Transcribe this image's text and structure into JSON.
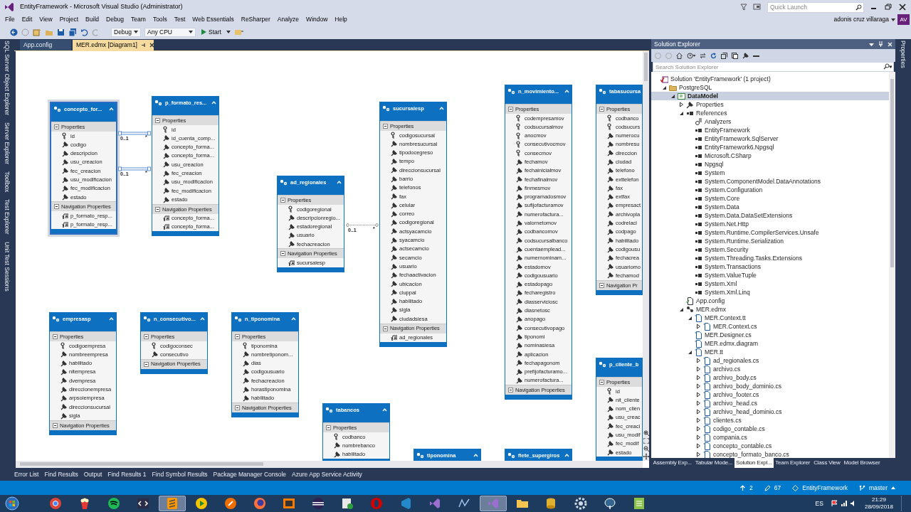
{
  "window": {
    "title": "EntityFramework - Microsoft Visual Studio (Administrator)"
  },
  "quick_launch": {
    "placeholder": "Quick Launch"
  },
  "user": {
    "name": "adonis cruz villaraga",
    "initials": "AV"
  },
  "menu": [
    "File",
    "Edit",
    "View",
    "Project",
    "Build",
    "Debug",
    "Team",
    "Tools",
    "Test",
    "Web Essentials",
    "ReSharper",
    "Analyze",
    "Window",
    "Help"
  ],
  "toolbar": {
    "configuration": "Debug",
    "platform": "Any CPU",
    "start": "Start"
  },
  "left_tool_strip": [
    "SQL Server Object Explorer",
    "Server Explorer",
    "Toolbox",
    "Test Explorer",
    "Unit Test Sessions"
  ],
  "right_tool_strip": [
    "Properties"
  ],
  "document_tabs": [
    {
      "label": "App.config",
      "selected": false
    },
    {
      "label": "MER.edmx [Diagram1]",
      "selected": true
    }
  ],
  "diagram": {
    "entities": [
      {
        "title": "concepto_for...",
        "selected": true,
        "properties_label": "Properties",
        "properties": [
          {
            "name": "id",
            "kind": "key"
          },
          {
            "name": "codigo",
            "kind": "scalar"
          },
          {
            "name": "descripcion",
            "kind": "scalar"
          },
          {
            "name": "usu_creacion",
            "kind": "scalar"
          },
          {
            "name": "fec_creacion",
            "kind": "scalar"
          },
          {
            "name": "usu_modificacion",
            "kind": "scalar"
          },
          {
            "name": "fec_modificacion",
            "kind": "scalar"
          },
          {
            "name": "estado",
            "kind": "scalar"
          }
        ],
        "navigation_label": "Navigation Properties",
        "navigation": [
          "p_formato_resp...",
          "p_formato_resp..."
        ]
      },
      {
        "title": "p_formato_res...",
        "selected": false,
        "properties_label": "Properties",
        "properties": [
          {
            "name": "id",
            "kind": "key"
          },
          {
            "name": "id_cuenta_comp...",
            "kind": "scalar"
          },
          {
            "name": "concepto_forma...",
            "kind": "scalar"
          },
          {
            "name": "concepto_forma...",
            "kind": "scalar"
          },
          {
            "name": "usu_creacion",
            "kind": "scalar"
          },
          {
            "name": "fec_creacion",
            "kind": "scalar"
          },
          {
            "name": "usu_modificacion",
            "kind": "scalar"
          },
          {
            "name": "fec_modificacion",
            "kind": "scalar"
          },
          {
            "name": "estado",
            "kind": "scalar"
          }
        ],
        "navigation_label": "Navigation Properties",
        "navigation": [
          "concepto_forma...",
          "concepto_forma..."
        ]
      },
      {
        "title": "ad_regionales",
        "selected": false,
        "properties_label": "Properties",
        "properties": [
          {
            "name": "codigoregional",
            "kind": "key"
          },
          {
            "name": "descripcionregio...",
            "kind": "scalar"
          },
          {
            "name": "estadoregional",
            "kind": "scalar"
          },
          {
            "name": "usuario",
            "kind": "scalar"
          },
          {
            "name": "fechacreacion",
            "kind": "scalar"
          }
        ],
        "navigation_label": "Navigation Properties",
        "navigation": [
          "sucursalesp"
        ]
      },
      {
        "title": "sucursalesp",
        "selected": false,
        "properties_label": "Properties",
        "properties": [
          {
            "name": "codigosucursal",
            "kind": "key"
          },
          {
            "name": "nombresucursal",
            "kind": "scalar"
          },
          {
            "name": "tipodocegreso",
            "kind": "scalar"
          },
          {
            "name": "tempo",
            "kind": "scalar"
          },
          {
            "name": "direccionsucursal",
            "kind": "scalar"
          },
          {
            "name": "barrio",
            "kind": "scalar"
          },
          {
            "name": "telefonos",
            "kind": "scalar"
          },
          {
            "name": "fax",
            "kind": "scalar"
          },
          {
            "name": "celular",
            "kind": "scalar"
          },
          {
            "name": "correo",
            "kind": "scalar"
          },
          {
            "name": "codigoregional",
            "kind": "scalar"
          },
          {
            "name": "actsyacamcio",
            "kind": "scalar"
          },
          {
            "name": "syacamcio",
            "kind": "scalar"
          },
          {
            "name": "actsecamcio",
            "kind": "scalar"
          },
          {
            "name": "secamcio",
            "kind": "scalar"
          },
          {
            "name": "usuario",
            "kind": "scalar"
          },
          {
            "name": "fechaactivacion",
            "kind": "scalar"
          },
          {
            "name": "ubicacion",
            "kind": "scalar"
          },
          {
            "name": "ciuppal",
            "kind": "scalar"
          },
          {
            "name": "habilitado",
            "kind": "scalar"
          },
          {
            "name": "sigla",
            "kind": "scalar"
          },
          {
            "name": "ciudadsiesa",
            "kind": "scalar"
          }
        ],
        "navigation_label": "Navigation Properties",
        "navigation": [
          "ad_regionales"
        ]
      },
      {
        "title": "n_movimiento...",
        "selected": false,
        "properties_label": "Properties",
        "properties": [
          {
            "name": "codempresamov",
            "kind": "key"
          },
          {
            "name": "codsucursalmov",
            "kind": "key"
          },
          {
            "name": "anocmov",
            "kind": "key"
          },
          {
            "name": "consecutivocmov",
            "kind": "key"
          },
          {
            "name": "consecmov",
            "kind": "key"
          },
          {
            "name": "fechamov",
            "kind": "scalar"
          },
          {
            "name": "fechainicialmov",
            "kind": "scalar"
          },
          {
            "name": "fechafinalmov",
            "kind": "scalar"
          },
          {
            "name": "finmesmov",
            "kind": "scalar"
          },
          {
            "name": "programadosmov",
            "kind": "scalar"
          },
          {
            "name": "sufijofacturamov",
            "kind": "scalar"
          },
          {
            "name": "numerofactura...",
            "kind": "scalar"
          },
          {
            "name": "valornetomov",
            "kind": "scalar"
          },
          {
            "name": "codbancomov",
            "kind": "scalar"
          },
          {
            "name": "codsucursalbanco",
            "kind": "scalar"
          },
          {
            "name": "cuentaemplead...",
            "kind": "scalar"
          },
          {
            "name": "numernominam...",
            "kind": "scalar"
          },
          {
            "name": "estadomov",
            "kind": "scalar"
          },
          {
            "name": "codigousuario",
            "kind": "scalar"
          },
          {
            "name": "estadopago",
            "kind": "scalar"
          },
          {
            "name": "fecharegistro",
            "kind": "scalar"
          },
          {
            "name": "diasserviciosc",
            "kind": "scalar"
          },
          {
            "name": "diasnetosc",
            "kind": "scalar"
          },
          {
            "name": "anopago",
            "kind": "scalar"
          },
          {
            "name": "consecutivopago",
            "kind": "scalar"
          },
          {
            "name": "tiponomi",
            "kind": "scalar"
          },
          {
            "name": "nominasiesa",
            "kind": "scalar"
          },
          {
            "name": "aplicacion",
            "kind": "scalar"
          },
          {
            "name": "fechapagonom",
            "kind": "scalar"
          },
          {
            "name": "prefijofacturamo...",
            "kind": "scalar"
          },
          {
            "name": "numerofactura...",
            "kind": "scalar"
          }
        ],
        "navigation_label": "Navigation Properties"
      },
      {
        "title": "tabasucursa",
        "selected": false,
        "properties_label": "Properties",
        "properties": [
          {
            "name": "codbanco",
            "kind": "key"
          },
          {
            "name": "codsucurs",
            "kind": "key"
          },
          {
            "name": "numerocu",
            "kind": "scalar"
          },
          {
            "name": "nombresu",
            "kind": "scalar"
          },
          {
            "name": "direccion",
            "kind": "scalar"
          },
          {
            "name": "ciudad",
            "kind": "scalar"
          },
          {
            "name": "telefono",
            "kind": "scalar"
          },
          {
            "name": "exttelefon",
            "kind": "scalar"
          },
          {
            "name": "fax",
            "kind": "scalar"
          },
          {
            "name": "extfax",
            "kind": "scalar"
          },
          {
            "name": "empresact",
            "kind": "scalar"
          },
          {
            "name": "archivopla",
            "kind": "scalar"
          },
          {
            "name": "codrelaci",
            "kind": "scalar"
          },
          {
            "name": "codpago",
            "kind": "scalar"
          },
          {
            "name": "habilitado",
            "kind": "scalar"
          },
          {
            "name": "codigousu",
            "kind": "scalar"
          },
          {
            "name": "fechacrea",
            "kind": "scalar"
          },
          {
            "name": "usuariomo",
            "kind": "scalar"
          },
          {
            "name": "fechamod",
            "kind": "scalar"
          }
        ],
        "navigation_label": "Navigation Pr"
      },
      {
        "title": "p_cliente_b",
        "selected": false,
        "properties_label": "Properties",
        "properties": [
          {
            "name": "id",
            "kind": "key"
          },
          {
            "name": "nit_cliente",
            "kind": "scalar"
          },
          {
            "name": "nom_clien",
            "kind": "scalar"
          },
          {
            "name": "usu_creac",
            "kind": "scalar"
          },
          {
            "name": "fec_creaci",
            "kind": "scalar"
          },
          {
            "name": "usu_modif",
            "kind": "scalar"
          },
          {
            "name": "fec_modif",
            "kind": "scalar"
          },
          {
            "name": "estado",
            "kind": "scalar"
          }
        ]
      },
      {
        "title": "empresasp",
        "selected": false,
        "properties_label": "Properties",
        "properties": [
          {
            "name": "codigoempresa",
            "kind": "key"
          },
          {
            "name": "nombreempresa",
            "kind": "scalar"
          },
          {
            "name": "habilitado",
            "kind": "scalar"
          },
          {
            "name": "nitempresa",
            "kind": "scalar"
          },
          {
            "name": "dvempresa",
            "kind": "scalar"
          },
          {
            "name": "direccionempresa",
            "kind": "scalar"
          },
          {
            "name": "arpsoiempresa",
            "kind": "scalar"
          },
          {
            "name": "direccionsucursal",
            "kind": "scalar"
          },
          {
            "name": "sigla",
            "kind": "scalar"
          }
        ],
        "navigation_label": "Navigation Properties"
      },
      {
        "title": "n_consecutivo...",
        "selected": false,
        "properties_label": "Properties",
        "properties": [
          {
            "name": "codigoconsec",
            "kind": "key"
          },
          {
            "name": "consecutivo",
            "kind": "scalar"
          }
        ],
        "navigation_label": "Navigation Properties"
      },
      {
        "title": "n_tiponomina",
        "selected": false,
        "properties_label": "Properties",
        "properties": [
          {
            "name": "tiponomina",
            "kind": "key"
          },
          {
            "name": "nombretiponom...",
            "kind": "scalar"
          },
          {
            "name": "dias",
            "kind": "scalar"
          },
          {
            "name": "codigousuario",
            "kind": "scalar"
          },
          {
            "name": "fechacreacion",
            "kind": "scalar"
          },
          {
            "name": "horastiponomina",
            "kind": "scalar"
          },
          {
            "name": "habilitado",
            "kind": "scalar"
          }
        ],
        "navigation_label": "Navigation Properties"
      },
      {
        "title": "tabancos",
        "selected": false,
        "properties_label": "Properties",
        "properties": [
          {
            "name": "codbanco",
            "kind": "key"
          },
          {
            "name": "nombrebanco",
            "kind": "scalar"
          },
          {
            "name": "habilitado",
            "kind": "scalar"
          }
        ]
      },
      {
        "title": "tiponomina",
        "selected": false
      },
      {
        "title": "flete_supergiros",
        "selected": false
      }
    ],
    "associations": [
      {
        "source_multiplicity": "0..1",
        "target_multiplicity": "*"
      },
      {
        "source_multiplicity": "0..1",
        "target_multiplicity": "*"
      },
      {
        "source_multiplicity": "0..1",
        "target_multiplicity": "*"
      }
    ]
  },
  "solution_explorer": {
    "title": "Solution Explorer",
    "search": {
      "placeholder": "Search Solution Explorer"
    },
    "tree": [
      {
        "label": "Solution 'EntityFramework' (1 project)",
        "kind": "solution",
        "selected": false,
        "children": [
          {
            "label": "PostgreSQL",
            "kind": "folder",
            "selected": false,
            "expanded": true,
            "children": [
              {
                "label": "DataModel",
                "kind": "project",
                "selected": true,
                "expanded": true,
                "children": [
                  {
                    "label": "Properties",
                    "kind": "wrench",
                    "selected": false,
                    "expanded": false
                  },
                  {
                    "label": "References",
                    "kind": "references",
                    "selected": false,
                    "expanded": true,
                    "children": [
                      {
                        "label": "Analyzers",
                        "kind": "analyzer",
                        "selected": false
                      },
                      {
                        "label": "EntityFramework",
                        "kind": "reference",
                        "selected": false
                      },
                      {
                        "label": "EntityFramework.SqlServer",
                        "kind": "reference",
                        "selected": false
                      },
                      {
                        "label": "EntityFramework6.Npgsql",
                        "kind": "reference",
                        "selected": false
                      },
                      {
                        "label": "Microsoft.CSharp",
                        "kind": "reference",
                        "selected": false
                      },
                      {
                        "label": "Npgsql",
                        "kind": "reference",
                        "selected": false
                      },
                      {
                        "label": "System",
                        "kind": "reference",
                        "selected": false
                      },
                      {
                        "label": "System.ComponentModel.DataAnnotations",
                        "kind": "reference",
                        "selected": false
                      },
                      {
                        "label": "System.Configuration",
                        "kind": "reference",
                        "selected": false
                      },
                      {
                        "label": "System.Core",
                        "kind": "reference",
                        "selected": false
                      },
                      {
                        "label": "System.Data",
                        "kind": "reference",
                        "selected": false
                      },
                      {
                        "label": "System.Data.DataSetExtensions",
                        "kind": "reference",
                        "selected": false
                      },
                      {
                        "label": "System.Net.Http",
                        "kind": "reference",
                        "selected": false
                      },
                      {
                        "label": "System.Runtime.CompilerServices.Unsafe",
                        "kind": "reference",
                        "selected": false
                      },
                      {
                        "label": "System.Runtime.Serialization",
                        "kind": "reference",
                        "selected": false
                      },
                      {
                        "label": "System.Security",
                        "kind": "reference",
                        "selected": false
                      },
                      {
                        "label": "System.Threading.Tasks.Extensions",
                        "kind": "reference",
                        "selected": false
                      },
                      {
                        "label": "System.Transactions",
                        "kind": "reference",
                        "selected": false
                      },
                      {
                        "label": "System.ValueTuple",
                        "kind": "reference",
                        "selected": false
                      },
                      {
                        "label": "System.Xml",
                        "kind": "reference",
                        "selected": false
                      },
                      {
                        "label": "System.Xml.Linq",
                        "kind": "reference",
                        "selected": false
                      }
                    ]
                  },
                  {
                    "label": "App.config",
                    "kind": "config",
                    "selected": false
                  },
                  {
                    "label": "MER.edmx",
                    "kind": "model",
                    "selected": false,
                    "expanded": true,
                    "children": [
                      {
                        "label": "MER.Context.tt",
                        "kind": "file",
                        "selected": false,
                        "expanded": true,
                        "children": [
                          {
                            "label": "MER.Context.cs",
                            "kind": "file",
                            "selected": false,
                            "expanded": false
                          }
                        ]
                      },
                      {
                        "label": "MER.Designer.cs",
                        "kind": "file",
                        "selected": false
                      },
                      {
                        "label": "MER.edmx.diagram",
                        "kind": "file",
                        "selected": false
                      },
                      {
                        "label": "MER.tt",
                        "kind": "file",
                        "selected": false,
                        "expanded": true,
                        "children": [
                          {
                            "label": "ad_regionales.cs",
                            "kind": "file",
                            "selected": false,
                            "expanded": false
                          },
                          {
                            "label": "archivo.cs",
                            "kind": "file",
                            "selected": false,
                            "expanded": false
                          },
                          {
                            "label": "archivo_body.cs",
                            "kind": "file",
                            "selected": false,
                            "expanded": false
                          },
                          {
                            "label": "archivo_body_dominio.cs",
                            "kind": "file",
                            "selected": false,
                            "expanded": false
                          },
                          {
                            "label": "archivo_footer.cs",
                            "kind": "file",
                            "selected": false,
                            "expanded": false
                          },
                          {
                            "label": "archivo_head.cs",
                            "kind": "file",
                            "selected": false,
                            "expanded": false
                          },
                          {
                            "label": "archivo_head_dominio.cs",
                            "kind": "file",
                            "selected": false,
                            "expanded": false
                          },
                          {
                            "label": "clientes.cs",
                            "kind": "file",
                            "selected": false,
                            "expanded": false
                          },
                          {
                            "label": "codigo_contable.cs",
                            "kind": "file",
                            "selected": false,
                            "expanded": false
                          },
                          {
                            "label": "compania.cs",
                            "kind": "file",
                            "selected": false,
                            "expanded": false
                          },
                          {
                            "label": "concepto_contable.cs",
                            "kind": "file",
                            "selected": false,
                            "expanded": false
                          },
                          {
                            "label": "concepto_formato_banco.cs",
                            "kind": "file",
                            "selected": false,
                            "expanded": false
                          }
                        ]
                      }
                    ]
                  }
                ]
              }
            ]
          }
        ]
      }
    ],
    "tabs": [
      {
        "label": "Assembly Exp...",
        "selected": false
      },
      {
        "label": "Tabular Mode...",
        "selected": false
      },
      {
        "label": "Solution Expl...",
        "selected": true
      },
      {
        "label": "Team Explorer",
        "selected": false
      },
      {
        "label": "Class View",
        "selected": false
      },
      {
        "label": "Model Browser",
        "selected": false
      }
    ]
  },
  "tool_windows": [
    "Error List",
    "Find Results",
    "Output",
    "Find Results 1",
    "Find Symbol Results",
    "Package Manager Console",
    "Azure App Service Activity"
  ],
  "status_bar": {
    "incoming": "2",
    "changes": "67",
    "repository": "EntityFramework",
    "branch": "master"
  },
  "taskbar": {
    "apps": [
      {
        "kind": "globe",
        "active": false
      },
      {
        "kind": "popcorn",
        "active": false
      },
      {
        "kind": "music",
        "active": false
      },
      {
        "kind": "code",
        "active": false
      },
      {
        "kind": "editor",
        "active": true
      },
      {
        "kind": "play",
        "active": false
      },
      {
        "kind": "rocket",
        "active": false
      },
      {
        "kind": "fox",
        "active": false
      },
      {
        "kind": "brackets",
        "active": false
      },
      {
        "kind": "eclipse",
        "active": false
      },
      {
        "kind": "run",
        "active": false
      },
      {
        "kind": "ring",
        "active": false
      },
      {
        "kind": "vscode",
        "active": false
      },
      {
        "kind": "vs",
        "active": false
      },
      {
        "kind": "graph",
        "active": false
      },
      {
        "kind": "vs",
        "active": true
      },
      {
        "kind": "folder",
        "active": false
      },
      {
        "kind": "database",
        "active": false
      },
      {
        "kind": "gear",
        "active": false
      },
      {
        "kind": "elephant",
        "active": false
      },
      {
        "kind": "notepad",
        "active": false
      }
    ],
    "language": "ES",
    "time": "21:29",
    "date": "28/09/2018"
  }
}
